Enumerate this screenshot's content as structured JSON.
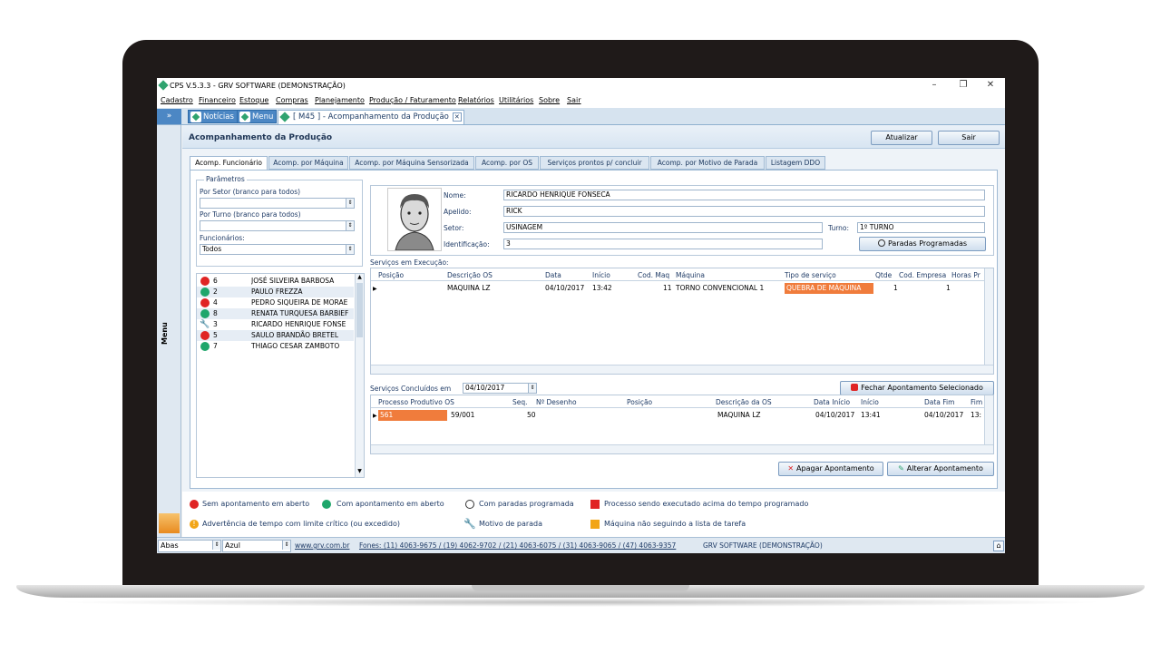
{
  "window": {
    "title": "CPS V.5.3.3 - GRV SOFTWARE (DEMONSTRAÇÃO)"
  },
  "menu": [
    "Cadastro",
    "Financeiro",
    "Estoque",
    "Compras",
    "Planejamento",
    "Produção / Faturamento",
    "Relatórios",
    "Utilitários",
    "Sobre",
    "Sair"
  ],
  "tabs": {
    "noticias": "Notícias",
    "menu": "Menu",
    "doc": "[ M45 ] - Acompanhamento da Produção"
  },
  "sidebar": {
    "chevron": "»",
    "label": "Menu"
  },
  "page": {
    "title": "Acompanhamento da Produção",
    "atualizar": "Atualizar",
    "sair": "Sair"
  },
  "subtabs": [
    "Acomp. Funcionário",
    "Acomp. por Máquina",
    "Acomp. por Máquina Sensorizada",
    "Acomp. por OS",
    "Serviços prontos p/ concluir",
    "Acomp. por Motivo de Parada",
    "Listagem DDO"
  ],
  "params": {
    "group": "Parâmetros",
    "setor_label": "Por Setor (branco para todos)",
    "setor_value": "",
    "turno_label": "Por Turno (branco para todos)",
    "turno_value": "",
    "func_label": "Funcionários:",
    "func_value": "Todos"
  },
  "employees": [
    {
      "status": "red",
      "code": "6",
      "name": "JOSÉ SILVEIRA BARBOSA"
    },
    {
      "status": "green",
      "code": "2",
      "name": "PAULO FREZZA"
    },
    {
      "status": "red",
      "code": "4",
      "name": "PEDRO SIQUEIRA DE MORAE"
    },
    {
      "status": "green",
      "code": "8",
      "name": "RENATA TURQUESA BARBIEF"
    },
    {
      "status": "wrench",
      "code": "3",
      "name": "RICARDO HENRIQUE FONSE"
    },
    {
      "status": "red",
      "code": "5",
      "name": "SAULO BRANDÃO BRETEL"
    },
    {
      "status": "green",
      "code": "7",
      "name": "THIAGO CESAR ZAMBOTO"
    }
  ],
  "person": {
    "nome_label": "Nome:",
    "nome": "RICARDO HENRIQUE FONSECA",
    "apelido_label": "Apelido:",
    "apelido": "RICK",
    "setor_label": "Setor:",
    "setor": "USINAGEM",
    "turno_label": "Turno:",
    "turno": "1º TURNO",
    "ident_label": "Identificação:",
    "ident": "3",
    "paradas": "Paradas Programadas"
  },
  "exec": {
    "label": "Serviços em Execução:",
    "headers": [
      "Posição",
      "Descrição OS",
      "Data",
      "Início",
      "Cod. Maq",
      "Máquina",
      "Tipo de serviço",
      "Qtde",
      "Cod. Empresa",
      "Horas Pr"
    ],
    "row": {
      "desc": "MAQUINA LZ",
      "data": "04/10/2017",
      "inicio": "13:42",
      "codmaq": "11",
      "maquina": "TORNO CONVENCIONAL 1",
      "tipo": "QUEBRA DE MÁQUINA",
      "qtde": "1",
      "empresa": "1"
    }
  },
  "done": {
    "label": "Serviços Concluídos em",
    "date": "04/10/2017",
    "fechar": "Fechar Apontamento Selecionado",
    "headers": [
      "Processo Produtivo OS",
      "Seq.",
      "Nº Desenho",
      "Posição",
      "Descrição da OS",
      "Data Início",
      "Início",
      "Data Fim",
      "Fim"
    ],
    "row": {
      "processo": "561",
      "os": "59/001",
      "seq": "50",
      "desc": "MAQUINA LZ",
      "data_ini": "04/10/2017",
      "ini": "13:41",
      "data_fim": "04/10/2017",
      "fim": "13:"
    }
  },
  "actions": {
    "apagar": "Apagar Apontamento",
    "alterar": "Alterar Apontamento"
  },
  "legend": {
    "sem": "Sem apontamento em aberto",
    "com": "Com apontamento em aberto",
    "paradas": "Com paradas programada",
    "acima": "Processo sendo executado acima do tempo programado",
    "advert": "Advertência de tempo com limite crítico (ou excedido)",
    "motivo": "Motivo de parada",
    "naoseg": "Máquina não seguindo a lista de tarefa"
  },
  "status": {
    "abas": "Abas",
    "azul": "Azul",
    "site": "www.grv.com.br",
    "fones": "Fones: (11) 4063-9675 / (19) 4062-9702 / (21) 4063-6075 / (31) 4063-9065 / (47) 4063-9357",
    "company": "GRV SOFTWARE (DEMONSTRAÇÃO)"
  },
  "colors": {
    "red": "#e02424",
    "green": "#1fa66b",
    "orange": "#f07c3c",
    "accent": "#4c87c4"
  }
}
